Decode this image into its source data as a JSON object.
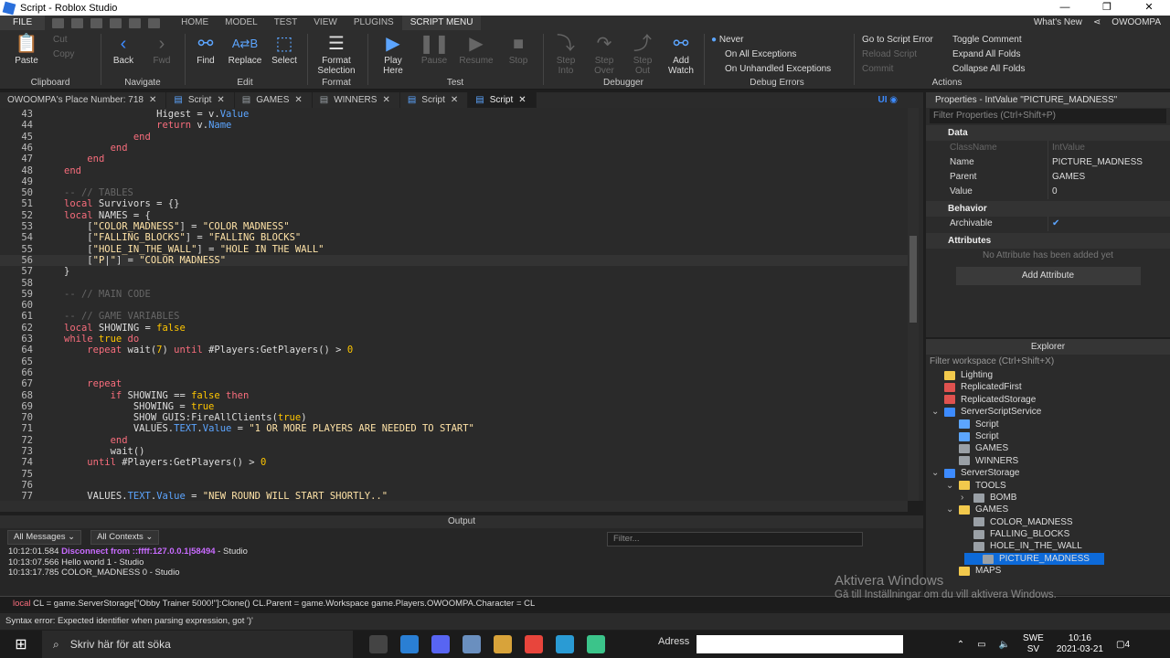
{
  "window": {
    "title": "Script - Roblox Studio",
    "controls": [
      "—",
      "❐",
      "✕"
    ]
  },
  "menubar": {
    "file": "FILE",
    "tabs": [
      "HOME",
      "MODEL",
      "TEST",
      "VIEW",
      "PLUGINS",
      "SCRIPT MENU"
    ],
    "right": {
      "whats_new": "What's New",
      "user": "OWOOMPA"
    }
  },
  "ribbon": {
    "clipboard": {
      "paste": "Paste",
      "cut": "Cut",
      "copy": "Copy",
      "group": "Clipboard"
    },
    "navigate": {
      "back": "Back",
      "fwd": "Fwd",
      "group": "Navigate"
    },
    "edit": {
      "find": "Find",
      "replace": "Replace",
      "select": "Select",
      "group": "Edit"
    },
    "format": {
      "format_selection": "Format Selection",
      "group": "Format"
    },
    "test": {
      "play_here": "Play Here",
      "pause": "Pause",
      "resume": "Resume",
      "stop": "Stop",
      "group": "Test"
    },
    "debugger": {
      "step_into": "Step Into",
      "step_over": "Step Over",
      "step_out": "Step Out",
      "add_watch": "Add Watch",
      "group": "Debugger"
    },
    "debug_errors": {
      "never": "Never",
      "on_all": "On All Exceptions",
      "on_unhandled": "On Unhandled Exceptions",
      "group": "Debug Errors"
    },
    "actions": {
      "goto_error": "Go to Script Error",
      "reload": "Reload Script",
      "commit": "Commit",
      "toggle_comment": "Toggle Comment",
      "expand": "Expand All Folds",
      "collapse": "Collapse All Folds",
      "group": "Actions"
    }
  },
  "doctabs": [
    {
      "label": "OWOOMPA's Place Number: 718",
      "active": false
    },
    {
      "label": "Script",
      "active": false
    },
    {
      "label": "GAMES",
      "active": false
    },
    {
      "label": "WINNERS",
      "active": false
    },
    {
      "label": "Script",
      "active": false
    },
    {
      "label": "Script",
      "active": true
    }
  ],
  "doctabs_ui": "UI",
  "code": [
    {
      "n": "43",
      "html": "                <span class='tx'>Higest = v.</span><span class='prop'>Value</span>"
    },
    {
      "n": "44",
      "html": "                <span class='kw'>return</span><span class='tx'> v.</span><span class='prop'>Name</span>"
    },
    {
      "n": "45",
      "html": "            <span class='kw'>end</span>"
    },
    {
      "n": "46",
      "html": "        <span class='kw'>end</span>"
    },
    {
      "n": "47",
      "html": "    <span class='kw'>end</span>"
    },
    {
      "n": "48",
      "html": "<span class='kw'>end</span>"
    },
    {
      "n": "49",
      "html": ""
    },
    {
      "n": "50",
      "html": "<span class='cm'>-- // TABLES</span>"
    },
    {
      "n": "51",
      "html": "<span class='kw'>local</span><span class='tx'> Survivors = {}</span>"
    },
    {
      "n": "52",
      "html": "<span class='kw'>local</span><span class='tx'> NAMES = {</span>"
    },
    {
      "n": "53",
      "html": "    <span class='tx'>[</span><span class='str'>\"COLOR_MADNESS\"</span><span class='tx'>] = </span><span class='str'>\"COLOR MADNESS\"</span>"
    },
    {
      "n": "54",
      "html": "    <span class='tx'>[</span><span class='str'>\"FALLING_BLOCKS\"</span><span class='tx'>] = </span><span class='str'>\"FALLING BLOCKS\"</span>"
    },
    {
      "n": "55",
      "html": "    <span class='tx'>[</span><span class='str'>\"HOLE_IN_THE_WALL\"</span><span class='tx'>] = </span><span class='str'>\"HOLE IN THE WALL\"</span>"
    },
    {
      "n": "56",
      "html": "    <span class='tx'>[</span><span class='str'>\"P</span><span class='tx'>|</span><span class='str'>\"</span><span class='tx'>] = </span><span class='str'>\"COLOR MADNESS\"</span>"
    },
    {
      "n": "57",
      "html": "<span class='tx'>}</span>"
    },
    {
      "n": "58",
      "html": ""
    },
    {
      "n": "59",
      "html": "<span class='cm'>-- // MAIN CODE</span>"
    },
    {
      "n": "60",
      "html": ""
    },
    {
      "n": "61",
      "html": "<span class='cm'>-- // GAME VARIABLES</span>"
    },
    {
      "n": "62",
      "html": "<span class='kw'>local</span><span class='tx'> SHOWING = </span><span class='bool'>false</span>"
    },
    {
      "n": "63",
      "html": "<span class='kw'>while</span><span class='bool'> true</span><span class='kw'> do</span>"
    },
    {
      "n": "64",
      "html": "    <span class='kw'>repeat</span><span class='tx'> wait(</span><span class='num'>7</span><span class='tx'>) </span><span class='kw'>until</span><span class='tx'> #Players:GetPlayers() &gt; </span><span class='num'>0</span>"
    },
    {
      "n": "65",
      "html": ""
    },
    {
      "n": "66",
      "html": ""
    },
    {
      "n": "67",
      "html": "    <span class='kw'>repeat</span>"
    },
    {
      "n": "68",
      "html": "        <span class='kw'>if</span><span class='tx'> SHOWING == </span><span class='bool'>false</span><span class='kw'> then</span>"
    },
    {
      "n": "69",
      "html": "            <span class='tx'>SHOWING = </span><span class='bool'>true</span>"
    },
    {
      "n": "70",
      "html": "            <span class='tx'>SHOW_GUIS:FireAllClients(</span><span class='bool'>true</span><span class='tx'>)</span>"
    },
    {
      "n": "71",
      "html": "            <span class='tx'>VALUES.</span><span class='prop'>TEXT</span><span class='tx'>.</span><span class='prop'>Value</span><span class='tx'> = </span><span class='str'>\"1 OR MORE PLAYERS ARE NEEDED TO START\"</span>"
    },
    {
      "n": "72",
      "html": "        <span class='kw'>end</span>"
    },
    {
      "n": "73",
      "html": "        <span class='tx'>wait()</span>"
    },
    {
      "n": "74",
      "html": "    <span class='kw'>until</span><span class='tx'> #Players:GetPlayers() &gt; </span><span class='num'>0</span>"
    },
    {
      "n": "75",
      "html": ""
    },
    {
      "n": "76",
      "html": ""
    },
    {
      "n": "77",
      "html": "    <span class='tx'>VALUES.</span><span class='prop'>TEXT</span><span class='tx'>.</span><span class='prop'>Value</span><span class='tx'> = </span><span class='str'>\"NEW ROUND WILL START SHORTLY..\"</span>"
    }
  ],
  "output": {
    "title": "Output",
    "all_messages": "All Messages",
    "all_contexts": "All Contexts",
    "filter_placeholder": "Filter...",
    "messages": [
      {
        "time": "10:12:01.584",
        "text": "Disconnect from ::ffff:127.0.0.1|58494",
        "src": " - Studio",
        "color": "#c86bff"
      },
      {
        "time": "10:13:07.566",
        "text": "Hello world 1",
        "src": " - Studio",
        "color": "#dddddd"
      },
      {
        "time": "10:13:17.785",
        "text": "COLOR_MADNESS 0",
        "src": " - Studio",
        "color": "#dddddd"
      }
    ]
  },
  "command_bar": {
    "text_kw": "local",
    "text_rest": " CL = game.ServerStorage[\"Obby Trainer 5000!\"]:Clone() CL.Parent = game.Workspace game.Players.OWOOMPA.Character = CL"
  },
  "status_bar": "Syntax error: Expected identifier when parsing expression, got ')'",
  "properties": {
    "title": "Properties - IntValue \"PICTURE_MADNESS\"",
    "filter": "Filter Properties (Ctrl+Shift+P)",
    "data_cat": "Data",
    "rows": [
      {
        "k": "ClassName",
        "v": "IntValue",
        "dim": true
      },
      {
        "k": "Name",
        "v": "PICTURE_MADNESS",
        "dim": false
      },
      {
        "k": "Parent",
        "v": "GAMES",
        "dim": false
      },
      {
        "k": "Value",
        "v": "0",
        "dim": false
      }
    ],
    "behavior_cat": "Behavior",
    "archivable": "Archivable",
    "archivable_check": "✔",
    "attributes_cat": "Attributes",
    "no_attr": "No Attribute has been added yet",
    "add_attr": "Add Attribute"
  },
  "explorer": {
    "title": "Explorer",
    "filter": "Filter workspace (Ctrl+Shift+X)",
    "items": [
      {
        "label": "Lighting",
        "indent": 0,
        "icon": "#f2c94c",
        "sel": false,
        "arrow": ""
      },
      {
        "label": "ReplicatedFirst",
        "indent": 0,
        "icon": "#e0524f",
        "sel": false,
        "arrow": ""
      },
      {
        "label": "ReplicatedStorage",
        "indent": 0,
        "icon": "#e0524f",
        "sel": false,
        "arrow": ""
      },
      {
        "label": "ServerScriptService",
        "indent": 0,
        "icon": "#3d8bff",
        "sel": false,
        "arrow": "⌄"
      },
      {
        "label": "Script",
        "indent": 1,
        "icon": "#5ca5ff",
        "sel": false,
        "arrow": ""
      },
      {
        "label": "Script",
        "indent": 1,
        "icon": "#5ca5ff",
        "sel": false,
        "arrow": ""
      },
      {
        "label": "GAMES",
        "indent": 1,
        "icon": "#9aa0a6",
        "sel": false,
        "arrow": ""
      },
      {
        "label": "WINNERS",
        "indent": 1,
        "icon": "#9aa0a6",
        "sel": false,
        "arrow": ""
      },
      {
        "label": "ServerStorage",
        "indent": 0,
        "icon": "#3d8bff",
        "sel": false,
        "arrow": "⌄"
      },
      {
        "label": "TOOLS",
        "indent": 1,
        "icon": "#f2c94c",
        "sel": false,
        "arrow": "⌄"
      },
      {
        "label": "BOMB",
        "indent": 2,
        "icon": "#9aa0a6",
        "sel": false,
        "arrow": "›"
      },
      {
        "label": "GAMES",
        "indent": 1,
        "icon": "#f2c94c",
        "sel": false,
        "arrow": "⌄"
      },
      {
        "label": "COLOR_MADNESS",
        "indent": 2,
        "icon": "#9aa0a6",
        "sel": false,
        "arrow": ""
      },
      {
        "label": "FALLING_BLOCKS",
        "indent": 2,
        "icon": "#9aa0a6",
        "sel": false,
        "arrow": ""
      },
      {
        "label": "HOLE_IN_THE_WALL",
        "indent": 2,
        "icon": "#9aa0a6",
        "sel": false,
        "arrow": ""
      },
      {
        "label": "PICTURE_MADNESS",
        "indent": 2,
        "icon": "#9aa0a6",
        "sel": true,
        "arrow": ""
      },
      {
        "label": "MAPS",
        "indent": 1,
        "icon": "#f2c94c",
        "sel": false,
        "arrow": ""
      }
    ]
  },
  "watermark": {
    "line1": "Aktivera Windows",
    "line2": "Gå till Inställningar om du vill aktivera Windows."
  },
  "taskbar": {
    "search": "Skriv här för att söka",
    "address": "Adress",
    "lang_top": "SWE",
    "lang_bottom": "SV",
    "time": "10:16",
    "date": "2021-03-21",
    "notif": "4"
  }
}
